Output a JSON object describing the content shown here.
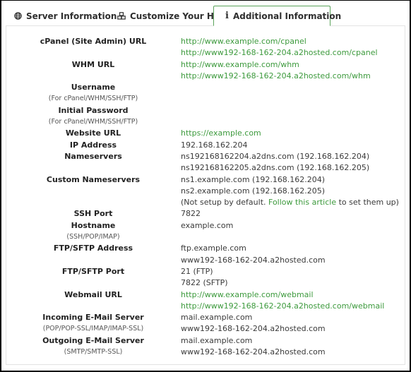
{
  "tabs": [
    {
      "label": "Server Information",
      "icon": "globe-icon",
      "active": false
    },
    {
      "label": "Customize Your Hosting",
      "icon": "cubes-icon",
      "active": false
    },
    {
      "label": "Additional Information",
      "icon": "info-icon",
      "active": true
    }
  ],
  "colors": {
    "link": "#3d9a3d",
    "active_tab_border": "#5aa35a",
    "panel_border": "#e3e3e3"
  },
  "fields": {
    "cpanel": {
      "label": "cPanel (Site Admin) URL",
      "values": [
        "http://www.example.com/cpanel",
        "http://www192-168-162-204.a2hosted.com/cpanel"
      ]
    },
    "whm": {
      "label": "WHM URL",
      "values": [
        "http://www.example.com/whm",
        "http://www192-168-162-204.a2hosted.com/whm"
      ]
    },
    "username": {
      "label": "Username",
      "note": "(For cPanel/WHM/SSH/FTP)"
    },
    "password": {
      "label": "Initial Password",
      "note": "(For cPanel/WHM/SSH/FTP)"
    },
    "website": {
      "label": "Website URL",
      "value": "https://example.com"
    },
    "ip": {
      "label": "IP Address",
      "value": "192.168.162.204"
    },
    "nameservers": {
      "label": "Nameservers",
      "values": [
        "ns192168162204.a2dns.com (192.168.162.204)",
        "ns192168162205.a2dns.com (192.168.162.205)"
      ]
    },
    "custom_ns": {
      "label": "Custom Nameservers",
      "values": [
        "ns1.example.com (192.168.162.204)",
        "ns2.example.com (192.168.162.205)"
      ],
      "note_before": "(Not setup by default. ",
      "note_link": "Follow this article",
      "note_after": " to set them up)"
    },
    "ssh_port": {
      "label": "SSH Port",
      "value": "7822"
    },
    "hostname": {
      "label": "Hostname",
      "note": "(SSH/POP/IMAP)",
      "value": "example.com"
    },
    "ftp_address": {
      "label": "FTP/SFTP Address",
      "values": [
        "ftp.example.com",
        "www192-168-162-204.a2hosted.com"
      ]
    },
    "ftp_port": {
      "label": "FTP/SFTP Port",
      "values": [
        "21 (FTP)",
        "7822 (SFTP)"
      ]
    },
    "webmail": {
      "label": "Webmail URL",
      "values": [
        "http://www.example.com/webmail",
        "http://www192-168-162-204.a2hosted.com/webmail"
      ]
    },
    "incoming": {
      "label": "Incoming E-Mail Server",
      "note": "(POP/POP-SSL/IMAP/IMAP-SSL)",
      "values": [
        "mail.example.com",
        "www192-168-162-204.a2hosted.com"
      ]
    },
    "outgoing": {
      "label": "Outgoing E-Mail Server",
      "note": "(SMTP/SMTP-SSL)",
      "values": [
        "mail.example.com",
        "www192-168-162-204.a2hosted.com"
      ]
    }
  }
}
